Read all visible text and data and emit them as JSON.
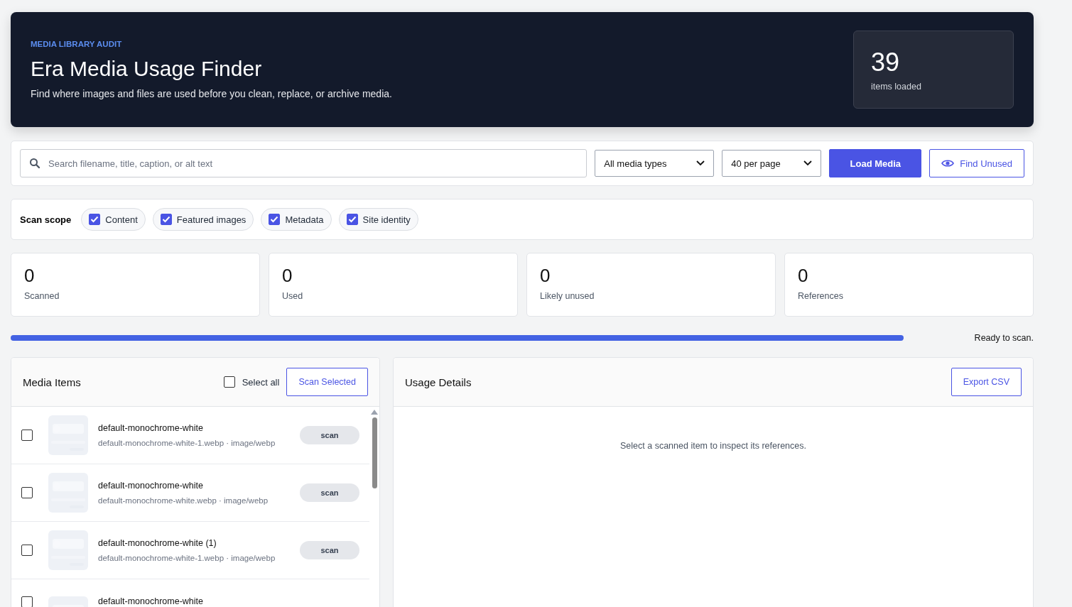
{
  "header": {
    "eyebrow": "MEDIA LIBRARY AUDIT",
    "title": "Era Media Usage Finder",
    "subtitle": "Find where images and files are used before you clean, replace, or archive media.",
    "stat": {
      "value": "39",
      "label": "items loaded"
    }
  },
  "toolbar": {
    "search": {
      "placeholder": "Search filename, title, caption, or alt text"
    },
    "type_select": "All media types",
    "page_select": "40 per page",
    "buttons": [
      {
        "label": "Load Media",
        "kind": "primary"
      },
      {
        "label": "Find Unused",
        "kind": "outline"
      }
    ]
  },
  "scan_scope": {
    "label": "Scan scope",
    "options": [
      {
        "label": "Content",
        "checked": true
      },
      {
        "label": "Featured images",
        "checked": true
      },
      {
        "label": "Metadata",
        "checked": true
      },
      {
        "label": "Site identity",
        "checked": true
      }
    ]
  },
  "stats": [
    {
      "value": "0",
      "label": "Scanned"
    },
    {
      "value": "0",
      "label": "Used"
    },
    {
      "value": "0",
      "label": "Likely unused"
    },
    {
      "value": "0",
      "label": "References"
    }
  ],
  "progress": {
    "level": 1,
    "status": "Ready to scan."
  },
  "media_items": {
    "title": "Media Items",
    "select_all": {
      "label": "Select all",
      "checked": false
    },
    "scan_selected": "Scan Selected",
    "items": [
      {
        "title": "default-monochrome-white",
        "meta": "default-monochrome-white-1.webp · image/webp",
        "checked": false,
        "action": "scan"
      },
      {
        "title": "default-monochrome-white",
        "meta": "default-monochrome-white.webp · image/webp",
        "checked": false,
        "action": "scan"
      },
      {
        "title": "default-monochrome-white (1)",
        "meta": "default-monochrome-white-1.webp · image/webp",
        "checked": false,
        "action": "scan"
      },
      {
        "title": "default-monochrome-white",
        "checked": false
      }
    ]
  },
  "usage_details": {
    "title": "Usage Details",
    "export": "Export CSV",
    "empty": "Select a scanned item to inspect its references."
  }
}
